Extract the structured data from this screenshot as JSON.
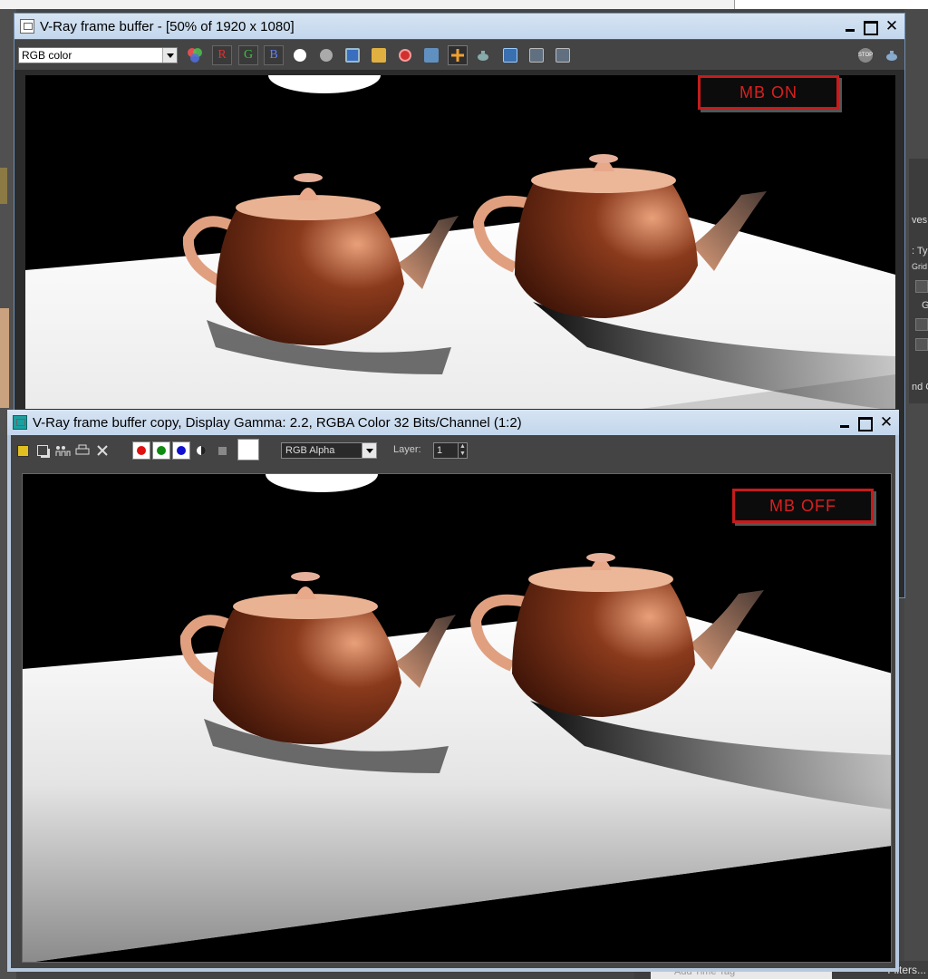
{
  "background_app": {
    "right_panel_texts": [
      "ves",
      ": Ty",
      "Grid",
      "G",
      "nd C"
    ],
    "bottom_tag": "Add Time Tag",
    "bottom_filters": "Filters..."
  },
  "window1": {
    "title": "V-Ray frame buffer - [50% of 1920 x 1080]",
    "channel_dropdown": "RGB color",
    "toolbar": {
      "r_label": "R",
      "g_label": "G",
      "b_label": "B",
      "stop_label": "STOP"
    },
    "overlay_label": "MB ON"
  },
  "window2": {
    "title": "V-Ray frame buffer copy, Display Gamma: 2.2, RGBA Color 32 Bits/Channel (1:2)",
    "channel_dropdown": "RGB Alpha",
    "layer_label": "Layer:",
    "layer_value": "1",
    "overlay_label": "MB OFF"
  },
  "colors": {
    "red_channel": "#e01010",
    "green_channel": "#108a10",
    "blue_channel": "#1010d0",
    "label_red": "#d82020",
    "teapot_body": "#6a2a14",
    "teapot_highlight": "#e8a07a"
  }
}
